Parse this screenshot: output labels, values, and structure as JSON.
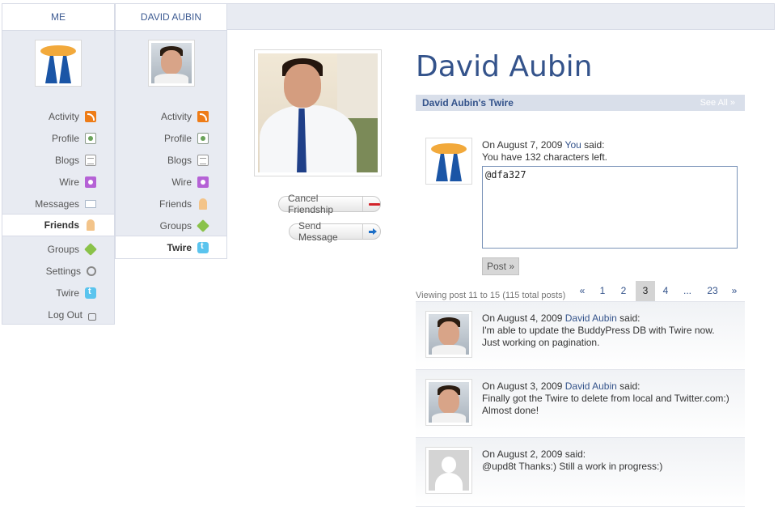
{
  "tabs": {
    "me": "ME",
    "david": "DAVID AUBIN"
  },
  "me_nav": [
    {
      "label": "Activity",
      "icon": "rss-icon"
    },
    {
      "label": "Profile",
      "icon": "profile-icon"
    },
    {
      "label": "Blogs",
      "icon": "blog-icon"
    },
    {
      "label": "Wire",
      "icon": "wire-icon"
    },
    {
      "label": "Messages",
      "icon": "envelope-icon"
    },
    {
      "label": "Friends",
      "icon": "friends-icon",
      "active": true
    },
    {
      "label": "Groups",
      "icon": "cube-icon"
    },
    {
      "label": "Settings",
      "icon": "wrench-icon"
    },
    {
      "label": "Twire",
      "icon": "twitter-icon"
    },
    {
      "label": "Log Out",
      "icon": "lock-icon"
    }
  ],
  "david_nav": [
    {
      "label": "Activity",
      "icon": "rss-icon"
    },
    {
      "label": "Profile",
      "icon": "profile-icon"
    },
    {
      "label": "Blogs",
      "icon": "blog-icon"
    },
    {
      "label": "Wire",
      "icon": "wire-icon"
    },
    {
      "label": "Friends",
      "icon": "friends-icon"
    },
    {
      "label": "Groups",
      "icon": "cube-icon"
    },
    {
      "label": "Twire",
      "icon": "twitter-icon",
      "active": true
    }
  ],
  "actions": {
    "cancel_friendship": "Cancel Friendship",
    "send_message": "Send Message"
  },
  "profile": {
    "name": "David Aubin",
    "section_title": "David Aubin's Twire",
    "see_all": "See All »"
  },
  "compose": {
    "prefix": "On August 7, 2009",
    "author": "You",
    "suffix": "said:",
    "chars_left": "You have 132 characters left.",
    "value": "@dfa327",
    "post_button": "Post »"
  },
  "pagination": {
    "viewing": "Viewing post 11 to 15 (115 total posts)",
    "prev": "«",
    "pages": [
      "1",
      "2",
      "3",
      "4",
      "...",
      "23"
    ],
    "current": "3",
    "next": "»"
  },
  "posts": [
    {
      "date": "On August 4, 2009",
      "author": "David Aubin",
      "said": "said:",
      "line1": "I'm able to update the BuddyPress DB with Twire now.",
      "line2": "Just working on pagination."
    },
    {
      "date": "On August 3, 2009",
      "author": "David Aubin",
      "said": "said:",
      "line1": "Finally got the Twire to delete from local and Twitter.com:)",
      "line2": "Almost done!"
    },
    {
      "date": "On August 2, 2009",
      "author": "",
      "said": "said:",
      "line1": "@upd8t Thanks:) Still a work in progress:)",
      "line2": ""
    }
  ],
  "colors": {
    "accent": "#34538b",
    "nav_bg": "#e8ebf2",
    "bar_bg": "#d9dfea",
    "current_page_bg": "#d4d4d4"
  }
}
